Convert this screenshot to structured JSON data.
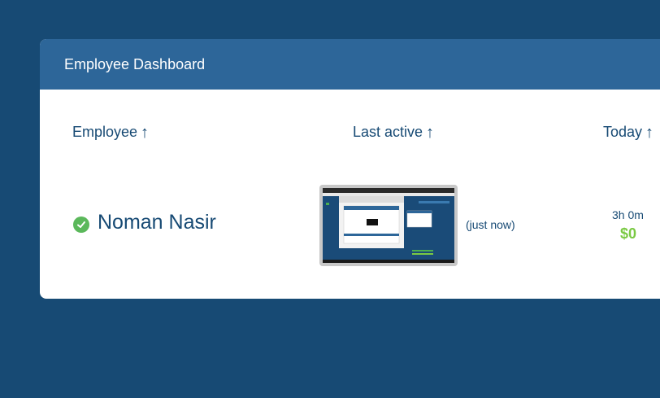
{
  "header": {
    "title": "Employee Dashboard"
  },
  "columns": {
    "employee": "Employee",
    "last_active": "Last active",
    "today": "Today",
    "sort_arrow": "↑"
  },
  "rows": [
    {
      "name": "Noman Nasir",
      "status": "online",
      "last_active": "(just now)",
      "today_hours": "3h 0m",
      "today_amount": "$0"
    }
  ],
  "colors": {
    "background": "#174a74",
    "header": "#2d6699",
    "text": "#174a74",
    "status_ok": "#5bb85b",
    "amount": "#7ac943"
  }
}
